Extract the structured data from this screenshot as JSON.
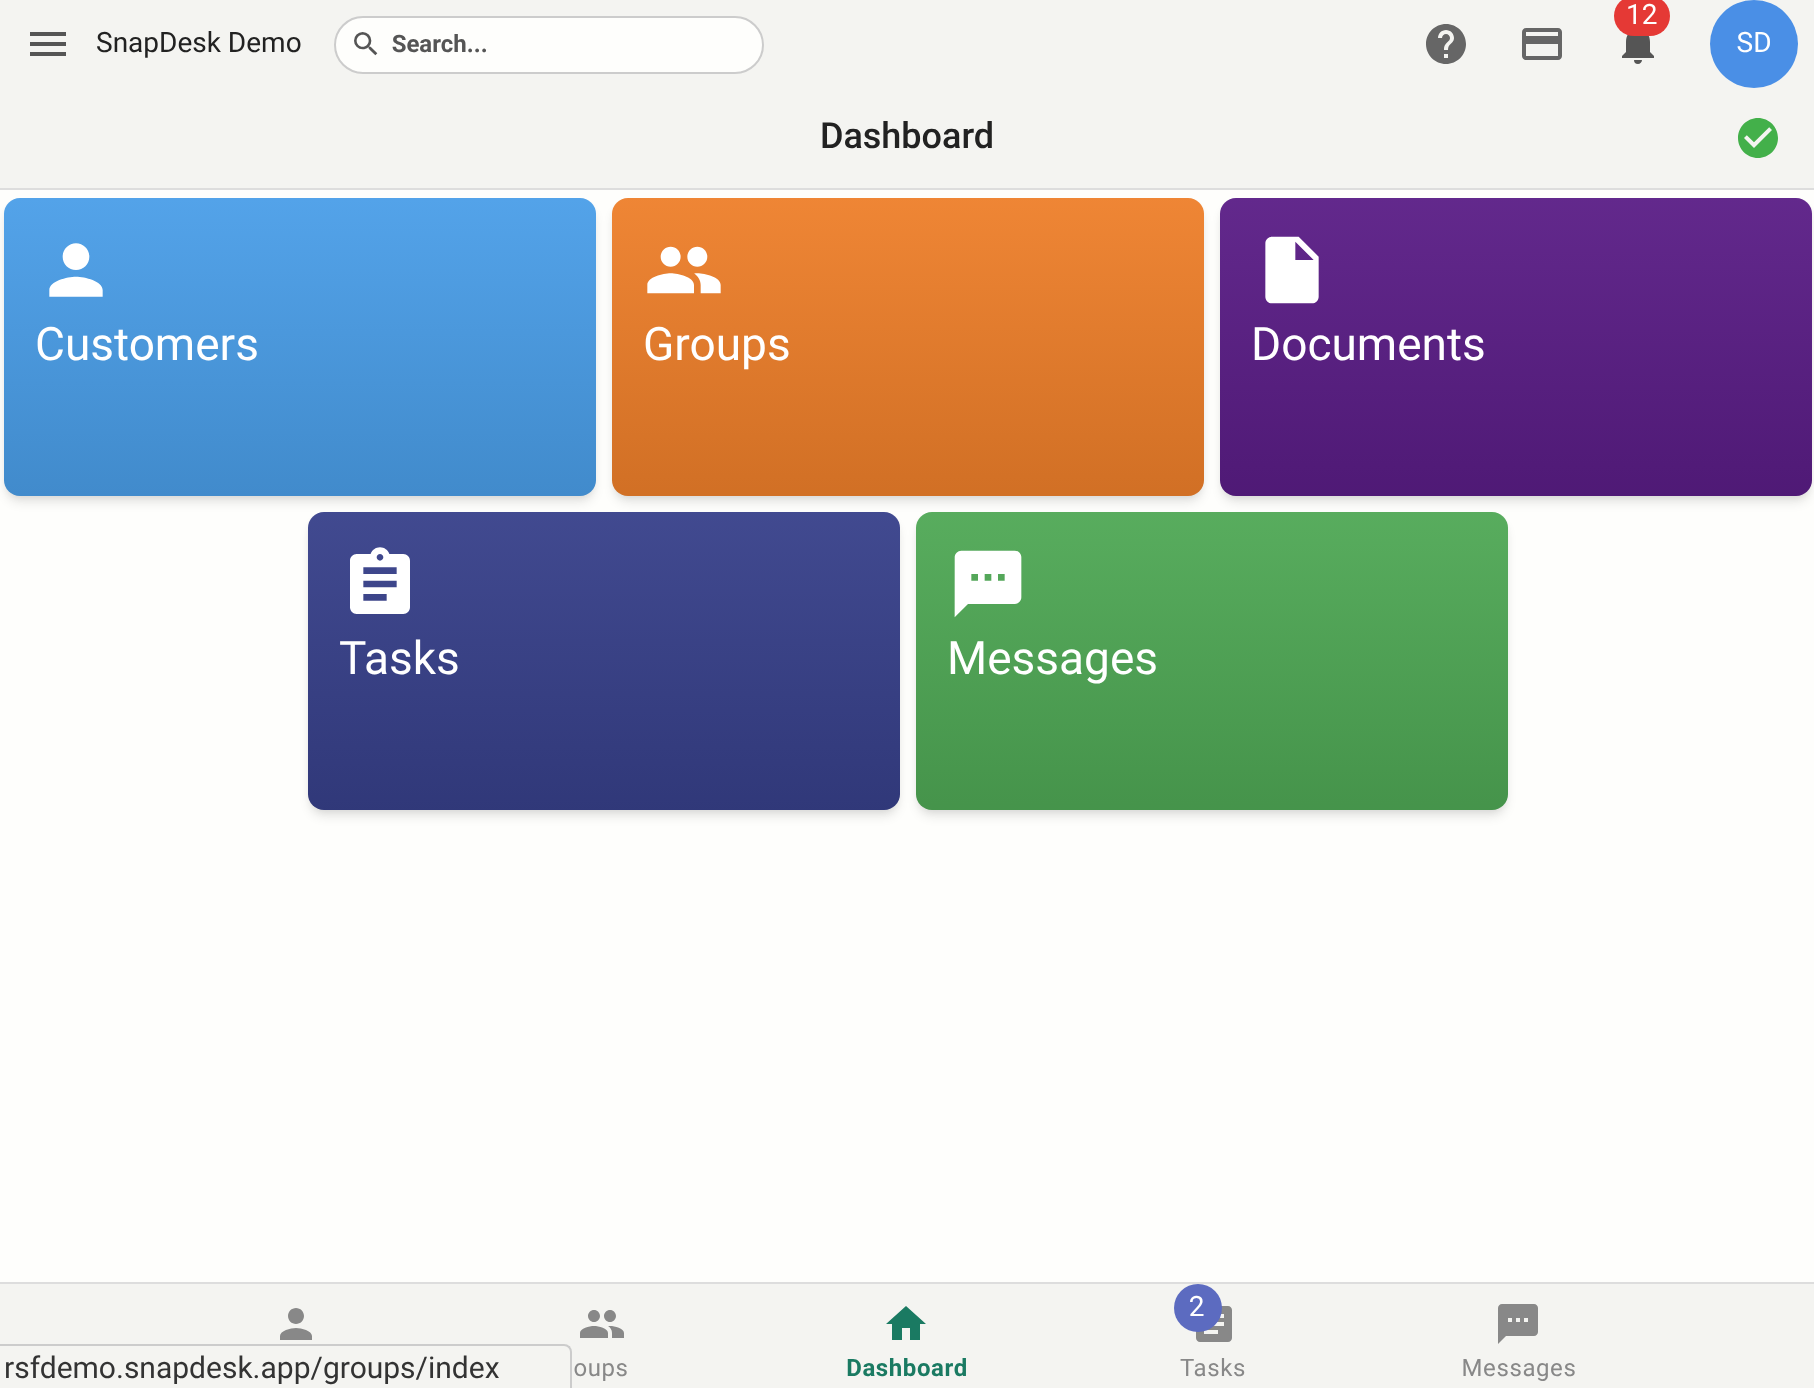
{
  "app_bar": {
    "title": "SnapDesk Demo",
    "search": {
      "placeholder": "Search..."
    },
    "notifications": {
      "count": "12"
    },
    "avatar": {
      "initials": "SD"
    }
  },
  "page": {
    "title": "Dashboard"
  },
  "tiles": [
    {
      "label": "Customers",
      "color": "#4a9ee8"
    },
    {
      "label": "Groups",
      "color": "#ee7f2a"
    },
    {
      "label": "Documents",
      "color": "#5a1d86"
    },
    {
      "label": "Tasks",
      "color": "#37408a"
    },
    {
      "label": "Messages",
      "color": "#4fa855"
    }
  ],
  "bottom_nav": [
    {
      "selected": false
    },
    {
      "label": "oups",
      "selected": false
    },
    {
      "label": "Dashboard",
      "selected": true
    },
    {
      "label": "Tasks",
      "selected": false,
      "badge": "2"
    },
    {
      "label": "Messages",
      "selected": false
    }
  ],
  "status_url": "rsfdemo.snapdesk.app/groups/index"
}
